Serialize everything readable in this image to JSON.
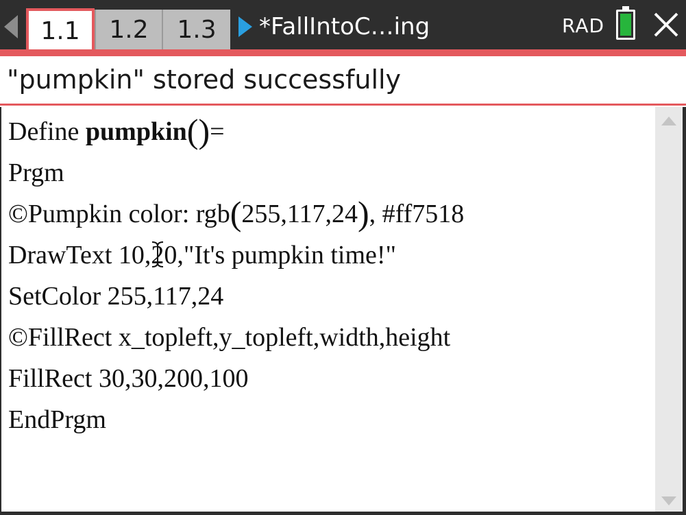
{
  "tabs": [
    {
      "label": "1.1",
      "active": true
    },
    {
      "label": "1.2",
      "active": false
    },
    {
      "label": "1.3",
      "active": false
    }
  ],
  "document": {
    "title": "*FallIntoC…ing"
  },
  "status_bar": {
    "angle_mode": "RAD",
    "battery_color": "#27b53c"
  },
  "message": {
    "text": "\"pumpkin\" stored successfully"
  },
  "editor": {
    "define_keyword": "Define ",
    "program_name": "pumpkin",
    "open_paren": "(",
    "close_paren": ")",
    "equals": "=",
    "lines": [
      "Prgm",
      "©Pumpkin color: rgb",
      "255,117,24",
      ", #ff7518",
      "DrawText 10,20,\"It's pumpkin time!\"",
      "SetColor 255,117,24",
      "©FillRect x_topleft,y_topleft,width,height",
      "FillRect 30,30,200,100",
      "EndPrgm"
    ]
  },
  "colors": {
    "accent": "#e4595d",
    "header_bg": "#2e2e2e",
    "doc_arrow": "#2a9fe0"
  }
}
